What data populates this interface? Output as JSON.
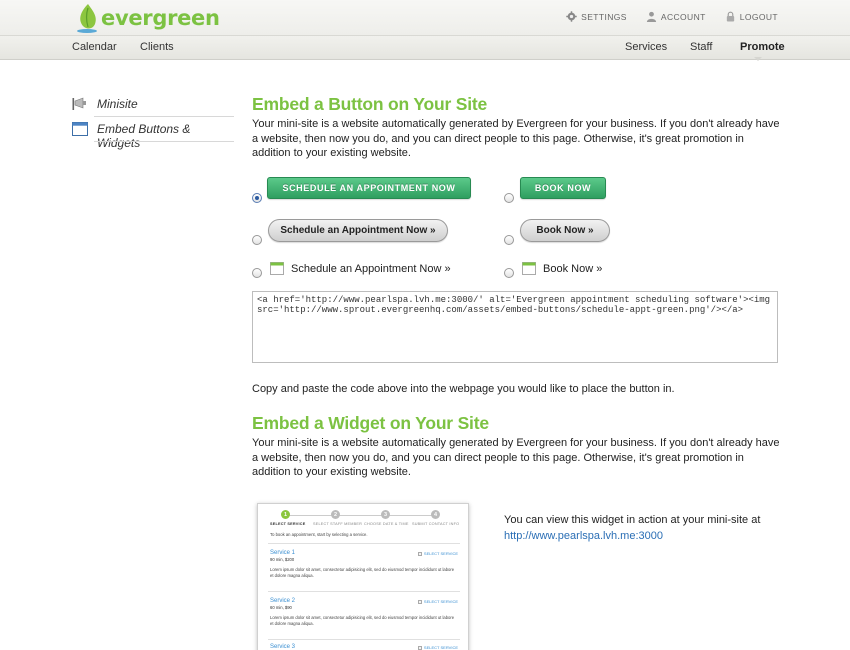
{
  "header": {
    "logo_text": "evergreen",
    "links": [
      {
        "label": "SETTINGS",
        "icon": "gear-icon"
      },
      {
        "label": "ACCOUNT",
        "icon": "person-icon"
      },
      {
        "label": "LOGOUT",
        "icon": "lock-icon"
      }
    ]
  },
  "nav": {
    "left": [
      "Calendar",
      "Clients"
    ],
    "right": [
      "Services",
      "Staff",
      "Promote"
    ],
    "active": "Promote"
  },
  "sidebar": {
    "items": [
      {
        "label": "Minisite",
        "icon": "megaphone-icon"
      },
      {
        "label": "Embed Buttons & Widgets",
        "icon": "window-icon"
      }
    ]
  },
  "embed_button": {
    "title": "Embed a Button on Your Site",
    "description": "Your mini-site is a website automatically generated by Evergreen for your business. If you don't already have a website, then now you do, and you can direct people to this page. Otherwise, it's great promotion in addition to your existing website.",
    "options": {
      "green_long": "SCHEDULE AN APPOINTMENT NOW",
      "green_short": "BOOK NOW",
      "gray_long": "Schedule an Appointment Now »",
      "gray_short": "Book Now »",
      "plain_long": "Schedule an Appointment Now »",
      "plain_short": "Book Now »"
    },
    "selected_option": "green_long",
    "code": "<a href='http://www.pearlspa.lvh.me:3000/' alt='Evergreen appointment scheduling software'><img src='http://www.sprout.evergreenhq.com/assets/embed-buttons/schedule-appt-green.png'/></a>",
    "instructions": "Copy and paste the code above into the webpage you would like to place the button in."
  },
  "embed_widget": {
    "title": "Embed a Widget on Your Site",
    "description": "Your mini-site is a website automatically generated by Evergreen for your business. If you don't already have a website, then now you do, and you can direct people to this page. Otherwise, it's great promotion in addition to your existing website.",
    "note": "You can view this widget in action at your mini-site at",
    "link": "http://www.pearlspa.lvh.me:3000",
    "preview": {
      "steps": [
        {
          "num": "1",
          "label": "SELECT SERVICE"
        },
        {
          "num": "2",
          "label": "SELECT STAFF MEMBER"
        },
        {
          "num": "3",
          "label": "CHOOSE DATE & TIME"
        },
        {
          "num": "4",
          "label": "SUBMIT CONTACT INFO"
        }
      ],
      "intro": "To book an appointment, start by selecting a service.",
      "select_label": "SELECT SERVICE",
      "services": [
        {
          "name": "Service 1",
          "meta": "90 min, $200",
          "desc": "Lorem ipsum dolor sit amet, consectetur adipisicing elit, sed do eiusmod tempor incididunt ut labore et dolore magna aliqua."
        },
        {
          "name": "Service 2",
          "meta": "60 min, $90",
          "desc": "Lorem ipsum dolor sit amet, consectetur adipisicing elit, sed do eiusmod tempor incididunt ut labore et dolore magna aliqua."
        },
        {
          "name": "Service 3",
          "meta": "",
          "desc": ""
        }
      ]
    }
  },
  "colors": {
    "brand_green": "#7cc242",
    "button_green": "#2f9f60",
    "link_blue": "#2a6eb5"
  }
}
